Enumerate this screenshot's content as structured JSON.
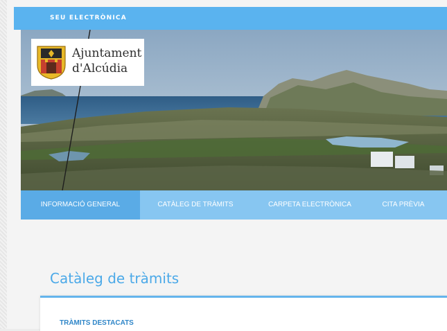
{
  "topbar": {
    "label": "SEU ELECTRÒNICA"
  },
  "logo": {
    "line1": "Ajuntament",
    "line2": "d'Alcúdia"
  },
  "nav": {
    "items": [
      {
        "label": "INFORMACIÓ GENERAL",
        "active": true
      },
      {
        "label": "CATÀLEG DE TRÀMITS",
        "active": false
      },
      {
        "label": "CARPETA ELECTRÒNICA",
        "active": false
      },
      {
        "label": "CITA PRÈVIA",
        "active": false
      }
    ]
  },
  "main": {
    "section_title": "Catàleg de tràmits",
    "card_heading": "TRÀMITS DESTACATS"
  },
  "colors": {
    "topbar": "#5ab3ef",
    "nav": "#87c6f1",
    "nav_active": "#5aabe6",
    "accent": "#4ba9e8"
  }
}
